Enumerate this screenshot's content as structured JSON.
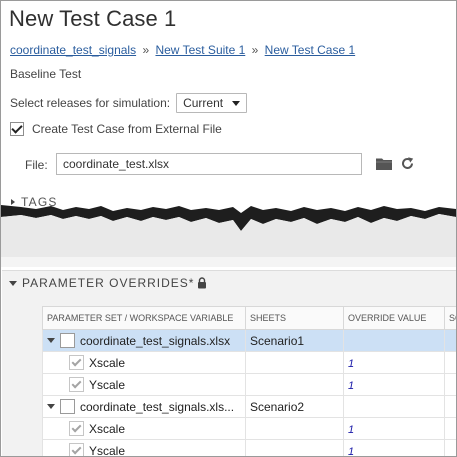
{
  "page": {
    "title": "New Test Case 1",
    "test_type": "Baseline Test"
  },
  "breadcrumb": {
    "items": [
      "coordinate_test_signals",
      "New Test Suite 1",
      "New Test Case 1"
    ],
    "separator": "»"
  },
  "releases": {
    "label": "Select releases for simulation:",
    "value": "Current"
  },
  "external_file": {
    "label": "Create Test Case from External File",
    "checked": true,
    "file_label": "File:",
    "file_value": "coordinate_test.xlsx",
    "icons": [
      "folder-icon",
      "refresh-icon"
    ]
  },
  "tags": {
    "label": "TAGS"
  },
  "parameter_overrides": {
    "label": "PARAMETER OVERRIDES*",
    "lock_icon": "lock-icon",
    "columns": [
      "PARAMETER SET / WORKSPACE VARIABLE",
      "SHEETS",
      "OVERRIDE VALUE",
      "SO"
    ],
    "rows": [
      {
        "name": "coordinate_test_signals.xlsx",
        "sheet": "Scenario1",
        "override": "",
        "level": 0,
        "selected": true
      },
      {
        "name": "Xscale",
        "sheet": "",
        "override": "1",
        "level": 1,
        "selected": false
      },
      {
        "name": "Yscale",
        "sheet": "",
        "override": "1",
        "level": 1,
        "selected": false
      },
      {
        "name": "coordinate_test_signals.xls...",
        "sheet": "Scenario2",
        "override": "",
        "level": 0,
        "selected": false
      },
      {
        "name": "Xscale",
        "sheet": "",
        "override": "1",
        "level": 1,
        "selected": false
      },
      {
        "name": "Yscale",
        "sheet": "",
        "override": "1",
        "level": 1,
        "selected": false
      }
    ]
  },
  "colors": {
    "link": "#2a5d9e",
    "selected_row": "#cce0f5",
    "override_value": "#1a1aa8"
  }
}
